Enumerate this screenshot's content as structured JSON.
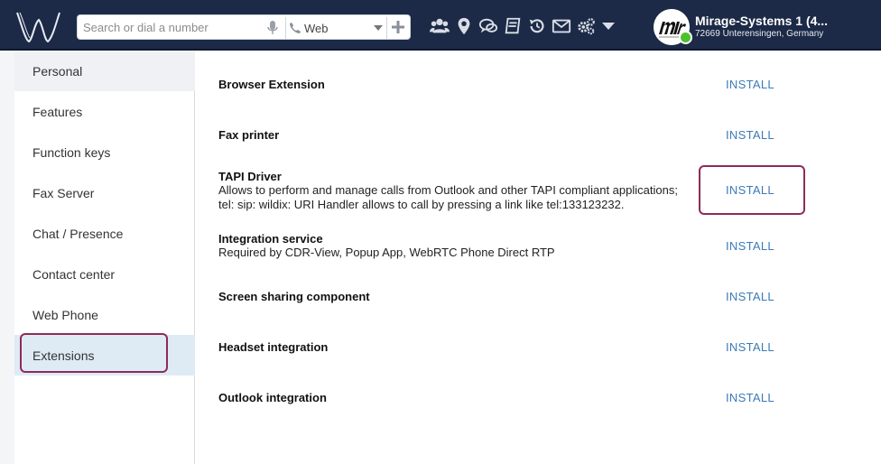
{
  "header": {
    "search_placeholder": "Search or dial a number",
    "channel": "Web",
    "account_name": "Mirage-Systems 1 (4...",
    "account_location": "72669 Unterensingen, Germany",
    "icons": [
      "contacts-icon",
      "map-marker-icon",
      "chat-icon",
      "book-icon",
      "history-icon",
      "mail-icon",
      "settings-icon",
      "dropdown-caret-icon"
    ]
  },
  "sidebar": {
    "items": [
      {
        "label": "Personal"
      },
      {
        "label": "Features"
      },
      {
        "label": "Function keys"
      },
      {
        "label": "Fax Server"
      },
      {
        "label": "Chat / Presence"
      },
      {
        "label": "Contact center"
      },
      {
        "label": "Web Phone"
      },
      {
        "label": "Extensions"
      }
    ]
  },
  "main": {
    "rows": [
      {
        "title": "Browser Extension",
        "desc1": "",
        "desc2": "",
        "action": "INSTALL"
      },
      {
        "title": "Fax printer",
        "desc1": "",
        "desc2": "",
        "action": "INSTALL"
      },
      {
        "title": "TAPI Driver",
        "desc1": "Allows to perform and manage calls from Outlook and other TAPI compliant applications;",
        "desc2": "tel: sip: wildix: URI Handler allows to call by pressing a link like tel:133123232.",
        "action": "INSTALL"
      },
      {
        "title": "Integration service",
        "desc1": "Required by CDR-View, Popup App, WebRTC Phone Direct RTP",
        "desc2": "",
        "action": "INSTALL"
      },
      {
        "title": "Screen sharing component",
        "desc1": "",
        "desc2": "",
        "action": "INSTALL"
      },
      {
        "title": "Headset integration",
        "desc1": "",
        "desc2": "",
        "action": "INSTALL"
      },
      {
        "title": "Outlook integration",
        "desc1": "",
        "desc2": "",
        "action": "INSTALL"
      }
    ]
  },
  "colors": {
    "topbar": "#1c2a47",
    "link": "#3c7ab7",
    "highlight": "#8e2a5a",
    "online": "#4cc12c"
  }
}
